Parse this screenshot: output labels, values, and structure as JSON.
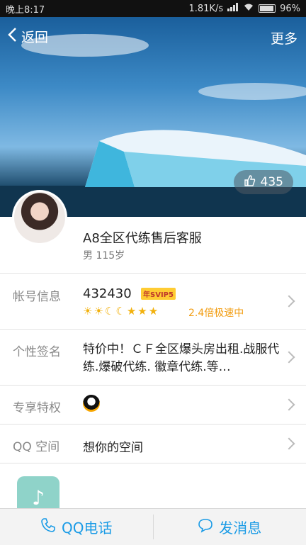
{
  "status_bar": {
    "time": "晚上8:17",
    "net_speed": "1.81K/s",
    "battery": "96%",
    "battery_level": 0.96
  },
  "header": {
    "back_label": "返回",
    "more_label": "更多"
  },
  "cover": {
    "likes": "435"
  },
  "profile": {
    "name": "A8全区代练售后客服",
    "gender_age": "男  115岁"
  },
  "account": {
    "label": "帐号信息",
    "number": "432430",
    "vip_badge": "年SVIP5",
    "speed_text": "2.4倍极速中",
    "level_icons": [
      "sun",
      "sun",
      "moon",
      "moon",
      "star",
      "star",
      "star"
    ]
  },
  "signature": {
    "label": "个性签名",
    "text": "特价中！ＣＦ全区爆头房出租.战服代练.爆破代练. 徽章代练.等…"
  },
  "privilege": {
    "label": "专享特权"
  },
  "qzone": {
    "label": "QQ 空间",
    "text": "想你的空间"
  },
  "bottom_bar": {
    "call_label": "QQ电话",
    "message_label": "发消息"
  },
  "colors": {
    "accent": "#1a9be6",
    "speed": "#f29d12"
  }
}
